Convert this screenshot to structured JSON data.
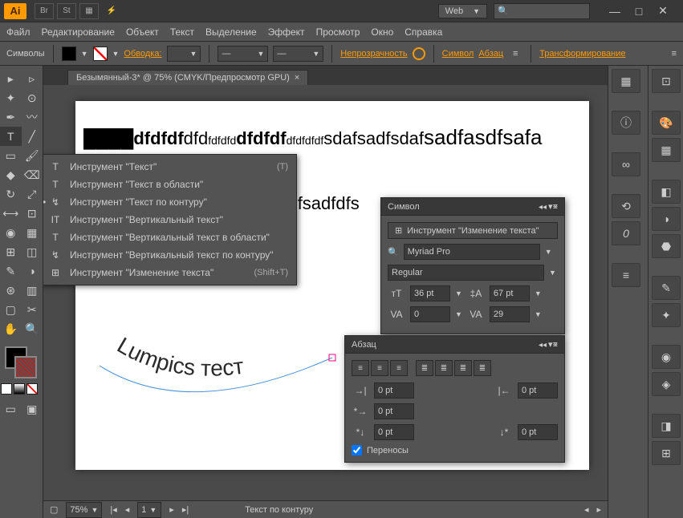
{
  "app": {
    "icon_text": "Ai"
  },
  "titlebar": {
    "br": "Br",
    "st": "St",
    "workspace": "Web",
    "search_placeholder": ""
  },
  "menu": [
    "Файл",
    "Редактирование",
    "Объект",
    "Текст",
    "Выделение",
    "Эффект",
    "Просмотр",
    "Окно",
    "Справка"
  ],
  "controlbar": {
    "symbols": "Символы",
    "stroke": "Обводка:",
    "opacity": "Непрозрачность",
    "character": "Символ",
    "paragraph": "Абзац",
    "transform": "Трансформирование"
  },
  "doc": {
    "tab": "Безымянный-3* @ 75% (CMYK/Предпросмотр GPU)",
    "text1_a": "dfdfdf",
    "text1_b": "dfd",
    "text1_c": "fdfdfd",
    "text1_d": "dfdfdf",
    "text1_e": "dfdfdfdf",
    "text1_f": "sdafsadfsdaf",
    "text1_g": "sadfasdfsafa",
    "text2": "fdfdfsadfdfs",
    "curve": "Lumpics тест"
  },
  "contextmenu": {
    "items": [
      {
        "icon": "T",
        "label": "Инструмент \"Текст\"",
        "shortcut": "(T)"
      },
      {
        "icon": "T",
        "label": "Инструмент \"Текст в области\"",
        "shortcut": ""
      },
      {
        "icon": "↯",
        "label": "Инструмент \"Текст по контуру\"",
        "shortcut": ""
      },
      {
        "icon": "IT",
        "label": "Инструмент \"Вертикальный текст\"",
        "shortcut": ""
      },
      {
        "icon": "T",
        "label": "Инструмент \"Вертикальный текст в области\"",
        "shortcut": ""
      },
      {
        "icon": "↯",
        "label": "Инструмент \"Вертикальный текст по контуру\"",
        "shortcut": ""
      },
      {
        "icon": "⊞",
        "label": "Инструмент \"Изменение текста\"",
        "shortcut": "(Shift+T)"
      }
    ]
  },
  "panel_char": {
    "title": "Символ",
    "tool_btn": "Инструмент \"Изменение текста\"",
    "font": "Myriad Pro",
    "style": "Regular",
    "size": "36 pt",
    "leading": "67 pt",
    "kerning": "0",
    "tracking": "29"
  },
  "panel_para": {
    "title": "Абзац",
    "indent_left": "0 pt",
    "indent_right": "0 pt",
    "first_line": "0 pt",
    "space_before": "0 pt",
    "space_after": "0 pt",
    "hyphenate": "Переносы"
  },
  "status": {
    "zoom": "75%",
    "tool": "Текст по контуру"
  }
}
